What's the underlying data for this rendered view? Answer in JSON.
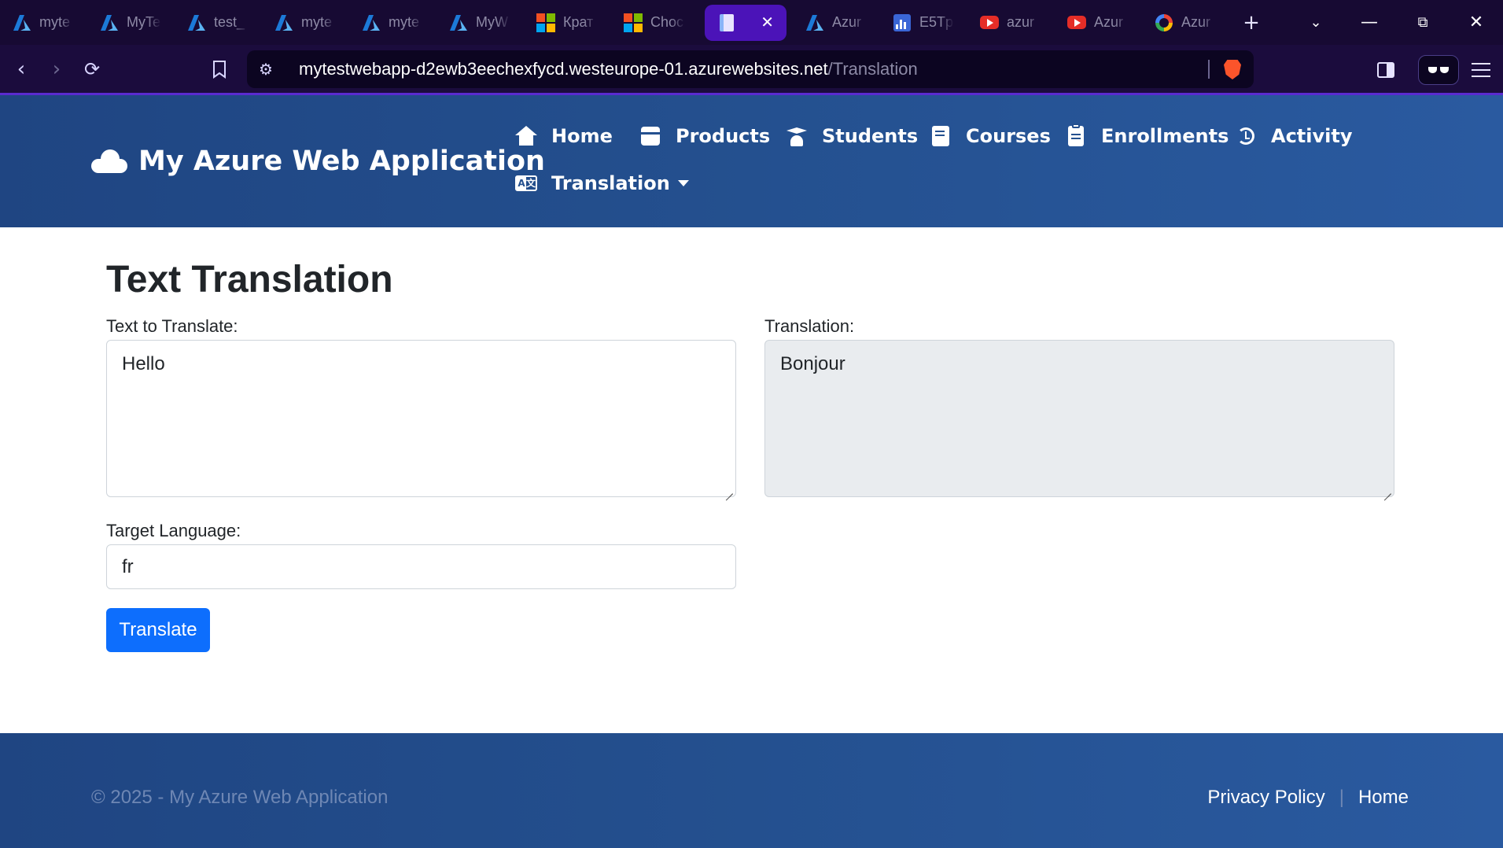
{
  "browser": {
    "tabs": [
      {
        "label": "myte",
        "icon": "azure-icon",
        "active": false
      },
      {
        "label": "MyTe",
        "icon": "azure-icon",
        "active": false
      },
      {
        "label": "test_",
        "icon": "azure-icon",
        "active": false
      },
      {
        "label": "myte",
        "icon": "azure-icon",
        "active": false
      },
      {
        "label": "myte",
        "icon": "azure-icon",
        "active": false
      },
      {
        "label": "MyW",
        "icon": "azure-icon",
        "active": false
      },
      {
        "label": "Крат",
        "icon": "microsoft-icon",
        "active": false
      },
      {
        "label": "Choc",
        "icon": "microsoft-icon",
        "active": false
      },
      {
        "label": "",
        "icon": "document-icon",
        "active": true
      },
      {
        "label": "Azur",
        "icon": "azure-icon",
        "active": false
      },
      {
        "label": "E5Tp",
        "icon": "chart-icon",
        "active": false
      },
      {
        "label": "azur",
        "icon": "youtube-icon",
        "active": false
      },
      {
        "label": "Azur",
        "icon": "youtube-icon",
        "active": false
      },
      {
        "label": "Azur",
        "icon": "google-icon",
        "active": false
      }
    ],
    "url_host": "mytestwebapp-d2ewb3eechexfycd.westeurope-01.azurewebsites.net",
    "url_path": "/Translation",
    "colors": {
      "tabstrip": "#170a33",
      "active_tab": "#4b13b8",
      "azure": "#1c7ad8",
      "brave": "#fb542b"
    }
  },
  "site": {
    "brand": "My Azure Web Application",
    "nav": {
      "home": "Home",
      "products": "Products",
      "students": "Students",
      "courses": "Courses",
      "enrollments": "Enrollments",
      "activity": "Activity",
      "translation": "Translation"
    },
    "colors": {
      "header": "#24508f",
      "primary_button": "#0d6efd"
    }
  },
  "main": {
    "title": "Text Translation",
    "source_label": "Text to Translate:",
    "source_value": "Hello",
    "result_label": "Translation:",
    "result_value": "Bonjour",
    "target_label": "Target Language:",
    "target_value": "fr",
    "translate_button": "Translate"
  },
  "footer": {
    "copyright": "© 2025 - My Azure Web Application",
    "privacy": "Privacy Policy",
    "separator": "|",
    "home": "Home"
  }
}
